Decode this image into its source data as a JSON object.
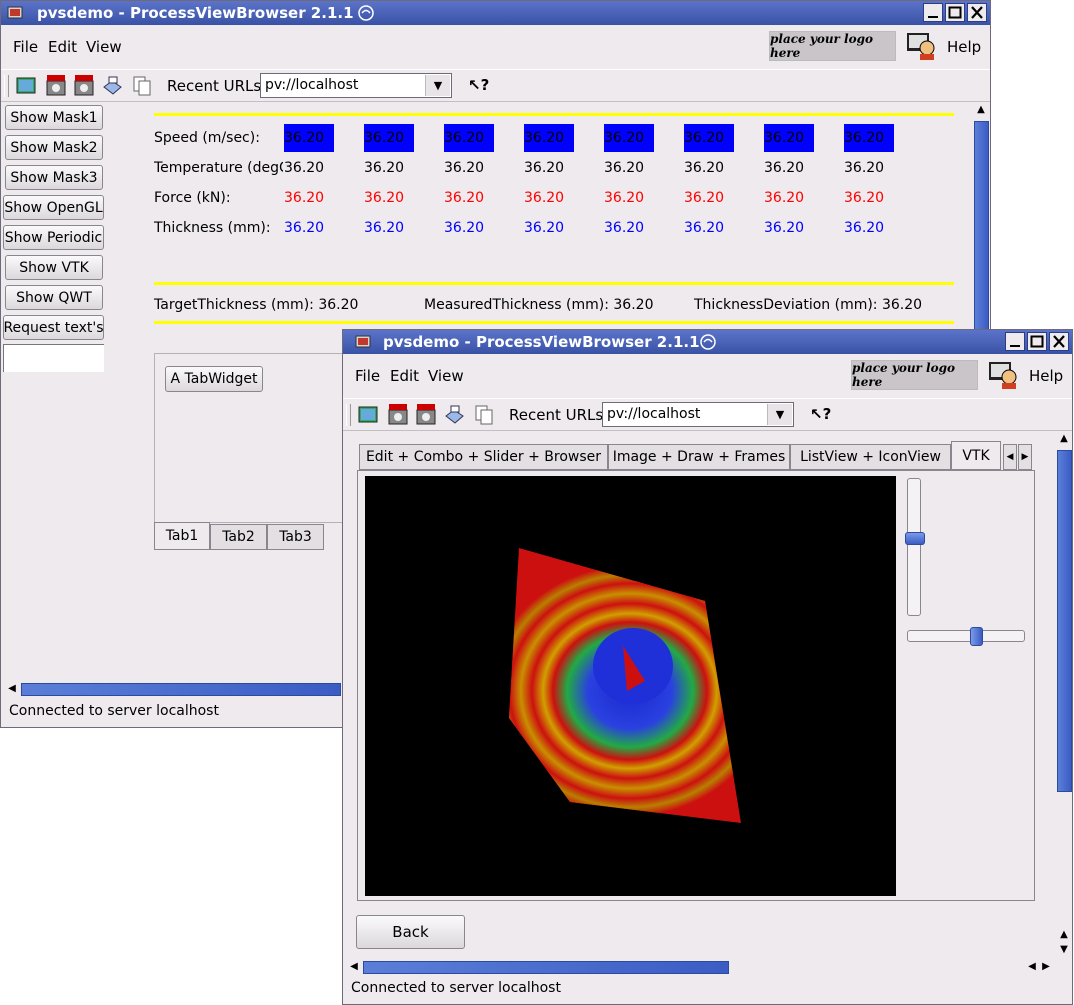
{
  "window1": {
    "title": "pvsdemo - ProcessViewBrowser 2.1.1",
    "menu": {
      "file": "File",
      "edit": "Edit",
      "view": "View"
    },
    "logo_text": "place your logo here",
    "help_label": "Help",
    "toolbar": {
      "recent_label": "Recent URLs",
      "url_value": "pv://localhost"
    },
    "side_buttons": [
      "Show Mask1",
      "Show Mask2",
      "Show Mask3",
      "Show OpenGL",
      "Show Periodic",
      "Show VTK",
      "Show QWT",
      "Request text's"
    ],
    "rows": {
      "speed_label": "Speed (m/sec):",
      "temperature_label": "Temperature (degC",
      "force_label": "Force (kN):",
      "thickness_label": "Thickness (mm):"
    },
    "speed_values": [
      "36.20",
      "36.20",
      "36.20",
      "36.20",
      "36.20",
      "36.20",
      "36.20",
      "36.20"
    ],
    "temperature_values": [
      "36.20",
      "36.20",
      "36.20",
      "36.20",
      "36.20",
      "36.20",
      "36.20",
      "36.20"
    ],
    "force_values": [
      "36.20",
      "36.20",
      "36.20",
      "36.20",
      "36.20",
      "36.20",
      "36.20",
      "36.20"
    ],
    "thickness_values": [
      "36.20",
      "36.20",
      "36.20",
      "36.20",
      "36.20",
      "36.20",
      "36.20",
      "36.20"
    ],
    "summary": {
      "target_label": "TargetThickness (mm): 36.20",
      "measured_label": "MeasuredThickness (mm): 36.20",
      "deviation_label": "ThicknessDeviation (mm): 36.20"
    },
    "tabwidget_button": "A TabWidget",
    "tabs": [
      "Tab1",
      "Tab2",
      "Tab3"
    ],
    "status": "Connected to server localhost"
  },
  "window2": {
    "title": "pvsdemo - ProcessViewBrowser 2.1.1",
    "menu": {
      "file": "File",
      "edit": "Edit",
      "view": "View"
    },
    "logo_text": "place your logo here",
    "help_label": "Help",
    "toolbar": {
      "recent_label": "Recent URLs",
      "url_value": "pv://localhost"
    },
    "tabs": [
      "Edit + Combo + Slider + Browser",
      "Image + Draw + Frames",
      "ListView + IconView",
      "VTK"
    ],
    "back_label": "Back",
    "status": "Connected to server localhost"
  },
  "colors": {
    "speed_box": "#0000ff",
    "force_text": "#ff0000",
    "thickness_text": "#0000ff",
    "separator": "#ffff00",
    "vtk_background": "#000000"
  }
}
